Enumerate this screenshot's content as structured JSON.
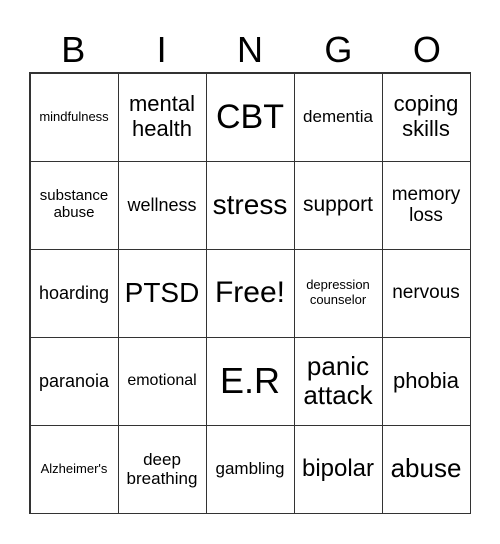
{
  "header": [
    "B",
    "I",
    "N",
    "G",
    "O"
  ],
  "cells": [
    [
      "mindfulness",
      "mental health",
      "CBT",
      "dementia",
      "coping skills"
    ],
    [
      "substance abuse",
      "wellness",
      "stress",
      "support",
      "memory loss"
    ],
    [
      "hoarding",
      "PTSD",
      "Free!",
      "depression counselor",
      "nervous"
    ],
    [
      "paranoia",
      "emotional",
      "E.R",
      "panic attack",
      "phobia"
    ],
    [
      "Alzheimer's",
      "deep breathing",
      "gambling",
      "bipolar",
      "abuse"
    ]
  ]
}
